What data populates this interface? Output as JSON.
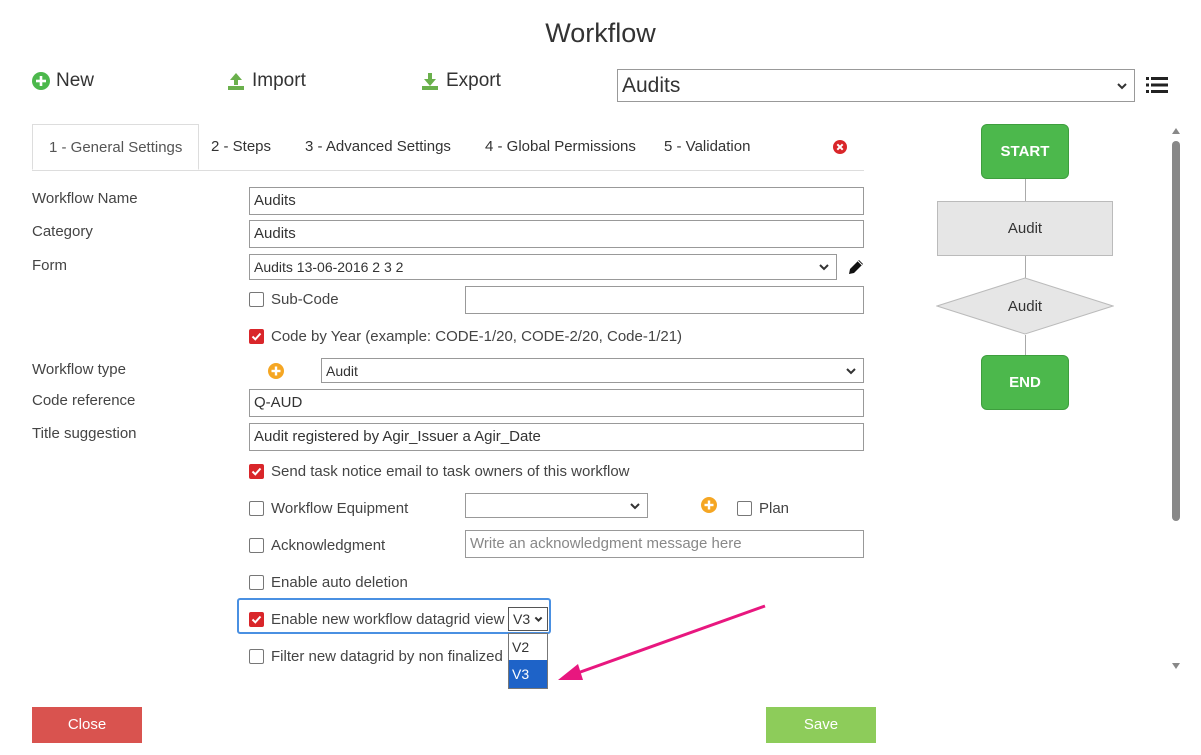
{
  "window": {
    "title": "Workflow"
  },
  "toolbar": {
    "new_label": "New",
    "import_label": "Import",
    "export_label": "Export",
    "workflow_select_value": "Audits"
  },
  "tabs": [
    {
      "label": "1 - General Settings",
      "active": true
    },
    {
      "label": "2 - Steps"
    },
    {
      "label": "3 - Advanced Settings"
    },
    {
      "label": "4 - Global Permissions"
    },
    {
      "label": "5 - Validation"
    }
  ],
  "form": {
    "workflow_name": {
      "label": "Workflow Name",
      "value": "Audits"
    },
    "category": {
      "label": "Category",
      "value": "Audits"
    },
    "form_field": {
      "label": "Form",
      "value": "Audits 13-06-2016 2 3 2"
    },
    "sub_code": {
      "label": "Sub-Code",
      "checked": false,
      "value": ""
    },
    "code_by_year": {
      "label": "Code by Year (example: CODE-1/20, CODE-2/20, Code-1/21)",
      "checked": true
    },
    "workflow_type": {
      "label": "Workflow type",
      "value": "Audit"
    },
    "code_reference": {
      "label": "Code reference",
      "value": "Q-AUD"
    },
    "title_suggestion": {
      "label": "Title suggestion",
      "value": "Audit registered by Agir_Issuer a Agir_Date"
    },
    "send_task_notice": {
      "label": "Send task notice email to task owners of this workflow",
      "checked": true
    },
    "workflow_equipment": {
      "label": "Workflow Equipment",
      "checked": false,
      "value": ""
    },
    "plan": {
      "label": "Plan",
      "checked": false
    },
    "acknowledgment": {
      "label": "Acknowledgment",
      "checked": false,
      "placeholder": "Write an acknowledgment message here"
    },
    "auto_deletion": {
      "label": "Enable auto deletion",
      "checked": false
    },
    "new_datagrid": {
      "label": "Enable new workflow datagrid view",
      "checked": true,
      "value": "V3",
      "options": [
        "V2",
        "V3"
      ]
    },
    "filter_datagrid": {
      "label": "Filter new datagrid by non finalized re",
      "checked": false
    }
  },
  "flow": {
    "start": "START",
    "step": "Audit",
    "decision": "Audit",
    "end": "END"
  },
  "footer": {
    "close_label": "Close",
    "save_label": "Save"
  },
  "colors": {
    "accent_red": "#d9262a",
    "green": "#4cb84c",
    "save_green": "#8dcc5a",
    "close_red": "#d9534f",
    "highlight_blue": "#4a90e2",
    "arrow_pink": "#e8177f",
    "orange": "#f5a623"
  }
}
